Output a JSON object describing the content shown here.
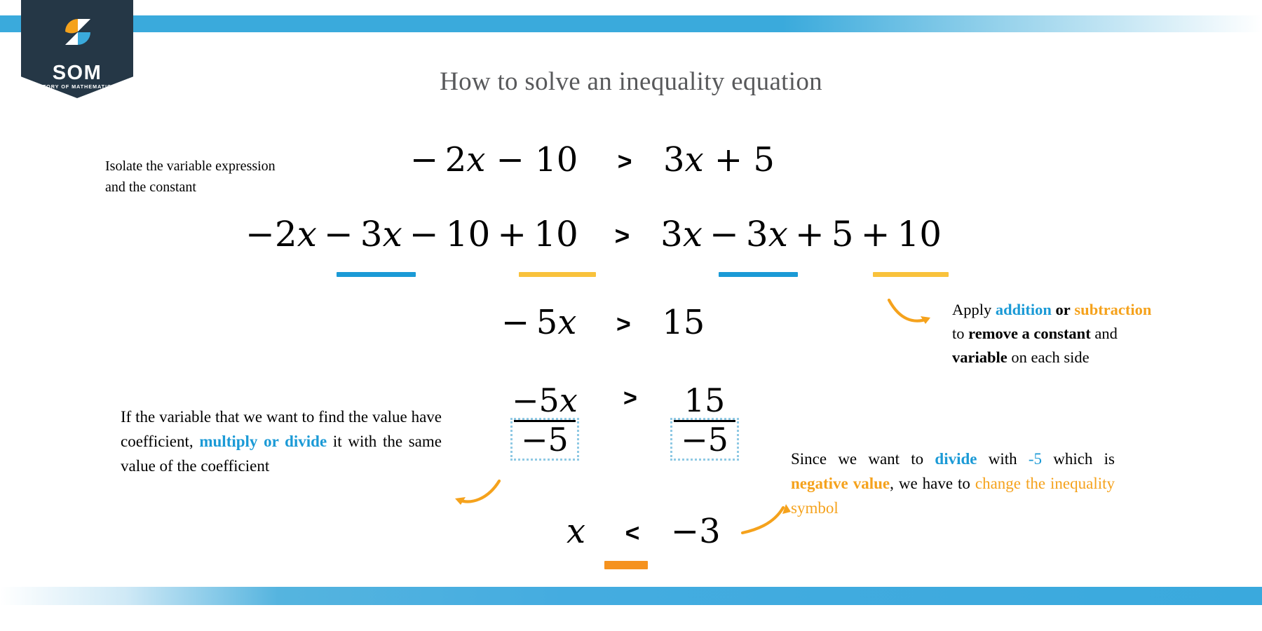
{
  "brand": {
    "name": "SOM",
    "tagline": "STORY OF MATHEMATICS",
    "pennant_color": "#253746",
    "accent_blue": "#3aaadc",
    "accent_orange": "#f5a21c"
  },
  "title": "How to solve an inequality equation",
  "colors": {
    "title_gray": "#58595b",
    "marker_blue": "#1b9ad6",
    "marker_amber": "#f9c23c",
    "marker_orange": "#f5921e",
    "dotted_box": "#8fc9e4",
    "arrow_orange": "#f5a21c",
    "emphasis_blue": "#1b9ad6",
    "emphasis_orange": "#f5a21c"
  },
  "steps": {
    "step1_label_line1": "Isolate the variable expression",
    "step1_label_line2": "and the constant"
  },
  "equations": {
    "line1": {
      "lhs": "− 2x − 10",
      "op": ">",
      "rhs": "3x + 5",
      "lhs_coef": "2",
      "lhs_const": "10",
      "rhs_coef": "3",
      "rhs_const": "5"
    },
    "line2": {
      "lhs": "−2x − 3x − 10 + 10",
      "op": ">",
      "rhs": "3x − 3x + 5 + 10"
    },
    "line3": {
      "lhs": "− 5x",
      "op": ">",
      "rhs": "15"
    },
    "line4": {
      "lhs_num": "−5x",
      "lhs_den": "−5",
      "op": ">",
      "rhs_num": "15",
      "rhs_den": "−5"
    },
    "line5": {
      "lhs": "x",
      "op": "<",
      "rhs": "−3"
    }
  },
  "notes": {
    "addition": {
      "seg1": "Apply ",
      "em_blue": "addition",
      "seg2": " ",
      "em_bold_or": "or",
      "seg3": " ",
      "em_orange": "subtraction",
      "line2_a": "to ",
      "line2_bold": "remove a constant",
      "line2_b": " and",
      "line3_bold": "variable",
      "line3_b": " on each side"
    },
    "coefficient": {
      "seg1": "If the variable that we want to find the value have coefficient, ",
      "em_blue": "multiply or divide",
      "seg2": " it with the same value of the coefficient"
    },
    "flip": {
      "seg1": "Since we want to ",
      "em_blue_divide": "divide",
      "seg2": " with ",
      "em_blue_val": "-5",
      "seg3": " which is ",
      "em_orange_bold": "negative value",
      "seg4": ", we have to ",
      "em_orange": "change the inequality symbol"
    }
  },
  "icons": {
    "arrow_right_curve": "curved-arrow-right",
    "arrow_left_curve": "curved-arrow-left",
    "arrow_upright_curve": "curved-arrow-up-right"
  }
}
